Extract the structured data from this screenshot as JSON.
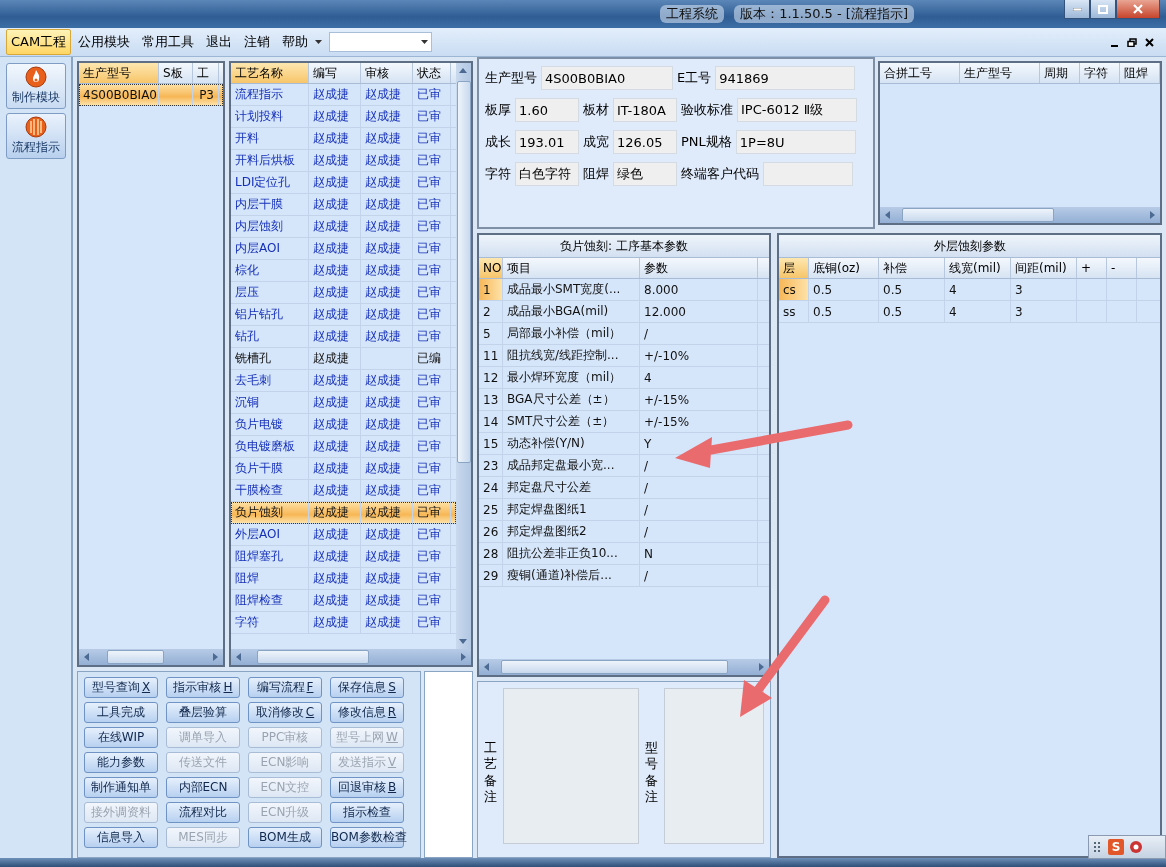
{
  "window": {
    "title": "工程系统",
    "version": "版本：1.1.50.5 - [流程指示]"
  },
  "menu": {
    "items": [
      {
        "label": "CAM工程",
        "selected": true
      },
      {
        "label": "公用模块",
        "selected": false
      },
      {
        "label": "常用工具",
        "selected": false
      },
      {
        "label": "退出",
        "selected": false
      },
      {
        "label": "注销",
        "selected": false
      },
      {
        "label": "帮助",
        "selected": false
      }
    ]
  },
  "nav": [
    {
      "label": "制作模块",
      "kind": "flame",
      "selected": false
    },
    {
      "label": "流程指示",
      "kind": "globe",
      "selected": true
    }
  ],
  "models": {
    "columns": [
      "生产型号",
      "S板",
      "工"
    ],
    "rows": [
      {
        "cells": [
          "4S00B0BIA0",
          "",
          "P3"
        ],
        "selected": true
      }
    ]
  },
  "process": {
    "columns": [
      "工艺名称",
      "编写",
      "审核",
      "状态"
    ],
    "rows": [
      {
        "name": "流程指示",
        "writer": "赵成捷",
        "reviewer": "赵成捷",
        "status": "已审",
        "reviewed": true,
        "selected": false
      },
      {
        "name": "计划投料",
        "writer": "赵成捷",
        "reviewer": "赵成捷",
        "status": "已审",
        "reviewed": true,
        "selected": false
      },
      {
        "name": "开料",
        "writer": "赵成捷",
        "reviewer": "赵成捷",
        "status": "已审",
        "reviewed": true,
        "selected": false
      },
      {
        "name": "开料后烘板",
        "writer": "赵成捷",
        "reviewer": "赵成捷",
        "status": "已审",
        "reviewed": true,
        "selected": false
      },
      {
        "name": "LDI定位孔",
        "writer": "赵成捷",
        "reviewer": "赵成捷",
        "status": "已审",
        "reviewed": true,
        "selected": false
      },
      {
        "name": "内层干膜",
        "writer": "赵成捷",
        "reviewer": "赵成捷",
        "status": "已审",
        "reviewed": true,
        "selected": false
      },
      {
        "name": "内层蚀刻",
        "writer": "赵成捷",
        "reviewer": "赵成捷",
        "status": "已审",
        "reviewed": true,
        "selected": false
      },
      {
        "name": "内层AOI",
        "writer": "赵成捷",
        "reviewer": "赵成捷",
        "status": "已审",
        "reviewed": true,
        "selected": false
      },
      {
        "name": "棕化",
        "writer": "赵成捷",
        "reviewer": "赵成捷",
        "status": "已审",
        "reviewed": true,
        "selected": false
      },
      {
        "name": "层压",
        "writer": "赵成捷",
        "reviewer": "赵成捷",
        "status": "已审",
        "reviewed": true,
        "selected": false
      },
      {
        "name": "铝片钻孔",
        "writer": "赵成捷",
        "reviewer": "赵成捷",
        "status": "已审",
        "reviewed": true,
        "selected": false
      },
      {
        "name": "钻孔",
        "writer": "赵成捷",
        "reviewer": "赵成捷",
        "status": "已审",
        "reviewed": true,
        "selected": false
      },
      {
        "name": "铣槽孔",
        "writer": "赵成捷",
        "status": "已编",
        "reviewed": false,
        "selected": false
      },
      {
        "name": "去毛刺",
        "writer": "赵成捷",
        "reviewer": "赵成捷",
        "status": "已审",
        "reviewed": true,
        "selected": false
      },
      {
        "name": "沉铜",
        "writer": "赵成捷",
        "reviewer": "赵成捷",
        "status": "已审",
        "reviewed": true,
        "selected": false
      },
      {
        "name": "负片电镀",
        "writer": "赵成捷",
        "reviewer": "赵成捷",
        "status": "已审",
        "reviewed": true,
        "selected": false
      },
      {
        "name": "负电镀磨板",
        "writer": "赵成捷",
        "reviewer": "赵成捷",
        "status": "已审",
        "reviewed": true,
        "selected": false
      },
      {
        "name": "负片干膜",
        "writer": "赵成捷",
        "reviewer": "赵成捷",
        "status": "已审",
        "reviewed": true,
        "selected": false
      },
      {
        "name": "干膜检查",
        "writer": "赵成捷",
        "reviewer": "赵成捷",
        "status": "已审",
        "reviewed": true,
        "selected": false
      },
      {
        "name": "负片蚀刻",
        "writer": "赵成捷",
        "reviewer": "赵成捷",
        "status": "已审",
        "reviewed": true,
        "selected": true
      },
      {
        "name": "外层AOI",
        "writer": "赵成捷",
        "reviewer": "赵成捷",
        "status": "已审",
        "reviewed": true,
        "selected": false
      },
      {
        "name": "阻焊塞孔",
        "writer": "赵成捷",
        "reviewer": "赵成捷",
        "status": "已审",
        "reviewed": true,
        "selected": false
      },
      {
        "name": "阻焊",
        "writer": "赵成捷",
        "reviewer": "赵成捷",
        "status": "已审",
        "reviewed": true,
        "selected": false
      },
      {
        "name": "阻焊检查",
        "writer": "赵成捷",
        "reviewer": "赵成捷",
        "status": "已审",
        "reviewed": true,
        "selected": false
      },
      {
        "name": "字符",
        "writer": "赵成捷",
        "reviewer": "赵成捷",
        "status": "已审",
        "reviewed": true,
        "selected": false
      }
    ]
  },
  "actions": [
    {
      "label": "型号查询",
      "key": "X",
      "disabled": false
    },
    {
      "label": "指示审核",
      "key": "H",
      "disabled": false
    },
    {
      "label": "编写流程",
      "key": "F",
      "disabled": false
    },
    {
      "label": "保存信息",
      "key": "S",
      "disabled": false
    },
    {
      "label": "工具完成",
      "disabled": false
    },
    {
      "label": "叠层验算",
      "disabled": false
    },
    {
      "label": "取消修改",
      "key": "C",
      "disabled": false
    },
    {
      "label": "修改信息",
      "key": "R",
      "disabled": false
    },
    {
      "label": "在线WIP",
      "disabled": false
    },
    {
      "label": "调单导入",
      "disabled": true
    },
    {
      "label": "PPC审核",
      "disabled": true
    },
    {
      "label": "型号上网",
      "key": "W",
      "disabled": true
    },
    {
      "label": "能力参数",
      "disabled": false
    },
    {
      "label": "传送文件",
      "disabled": true
    },
    {
      "label": "ECN影响",
      "disabled": true
    },
    {
      "label": "发送指示",
      "key": "V",
      "disabled": true
    },
    {
      "label": "制作通知单",
      "disabled": false
    },
    {
      "label": "内部ECN",
      "disabled": false
    },
    {
      "label": "ECN文控",
      "disabled": true
    },
    {
      "label": "回退审核",
      "key": "B",
      "disabled": false
    },
    {
      "label": "接外调资料",
      "disabled": true
    },
    {
      "label": "流程对比",
      "disabled": false
    },
    {
      "label": "ECN升级",
      "disabled": true
    },
    {
      "label": "指示检查",
      "disabled": false
    },
    {
      "label": "信息导入",
      "disabled": false
    },
    {
      "label": "MES同步",
      "disabled": true
    },
    {
      "label": "BOM生成",
      "disabled": false
    },
    {
      "label": "BOM参数检查",
      "disabled": false
    }
  ],
  "info": {
    "fields": [
      {
        "label": "生产型号",
        "value": "4S00B0BIA0"
      },
      {
        "label": "E工号",
        "value": "941869"
      },
      {
        "label": "板厚",
        "value": "1.60"
      },
      {
        "label": "板材",
        "value": "IT-180A"
      },
      {
        "label": "验收标准",
        "value": "IPC-6012 Ⅱ级"
      },
      {
        "label": "成长",
        "value": "193.01"
      },
      {
        "label": "成宽",
        "value": "126.05"
      },
      {
        "label": "PNL规格",
        "value": "1P=8U"
      },
      {
        "label": "字符",
        "value": "白色字符"
      },
      {
        "label": "阻焊",
        "value": "绿色"
      },
      {
        "label": "终端客户代码"
      }
    ]
  },
  "merge_table": {
    "columns": [
      "合拼工号",
      "生产型号",
      "周期",
      "字符",
      "阻焊"
    ]
  },
  "params": {
    "title": "负片蚀刻: 工序基本参数",
    "columns": [
      "NO",
      "项目",
      "参数"
    ],
    "rows": [
      {
        "no": "1",
        "item": "成品最小SMT宽度(...",
        "value": "8.000",
        "selected": true
      },
      {
        "no": "2",
        "item": "成品最小BGA(mil)",
        "value": "12.000",
        "selected": false
      },
      {
        "no": "5",
        "item": "局部最小补偿（mil）",
        "value": "/",
        "selected": false
      },
      {
        "no": "11",
        "item": "阻抗线宽/线距控制...",
        "value": "+/-10%",
        "selected": false
      },
      {
        "no": "12",
        "item": "最小焊环宽度（mil）",
        "value": "4",
        "selected": false
      },
      {
        "no": "13",
        "item": "BGA尺寸公差（±）",
        "value": "+/-15%",
        "selected": false
      },
      {
        "no": "14",
        "item": "SMT尺寸公差（±）",
        "value": "+/-15%",
        "selected": false
      },
      {
        "no": "15",
        "item": "动态补偿(Y/N)",
        "value": "Y",
        "selected": false
      },
      {
        "no": "23",
        "item": "成品邦定盘最小宽...",
        "value": "/",
        "selected": false
      },
      {
        "no": "24",
        "item": "邦定盘尺寸公差",
        "value": "/",
        "selected": false
      },
      {
        "no": "25",
        "item": "邦定焊盘图纸1",
        "value": "/",
        "selected": false
      },
      {
        "no": "26",
        "item": "邦定焊盘图纸2",
        "value": "/",
        "selected": false
      },
      {
        "no": "28",
        "item": "阻抗公差非正负10...",
        "value": "N",
        "selected": false
      },
      {
        "no": "29",
        "item": "瘦铜(通道)补偿后...",
        "value": "/",
        "selected": false
      }
    ]
  },
  "outer": {
    "title": "外层蚀刻参数",
    "columns": [
      "层",
      "底铜(oz)",
      "补偿",
      "线宽(mil)",
      "间距(mil)",
      "+",
      "-"
    ],
    "rows": [
      {
        "cells": [
          "cs",
          "0.5",
          "0.5",
          "4",
          "3",
          "",
          ""
        ],
        "selected": true
      },
      {
        "cells": [
          "ss",
          "0.5",
          "0.5",
          "4",
          "3",
          "",
          ""
        ],
        "selected": false
      }
    ]
  },
  "notes": [
    {
      "label": "工艺备注"
    },
    {
      "label": "型号备注"
    }
  ],
  "tray": {
    "badge": "S"
  }
}
